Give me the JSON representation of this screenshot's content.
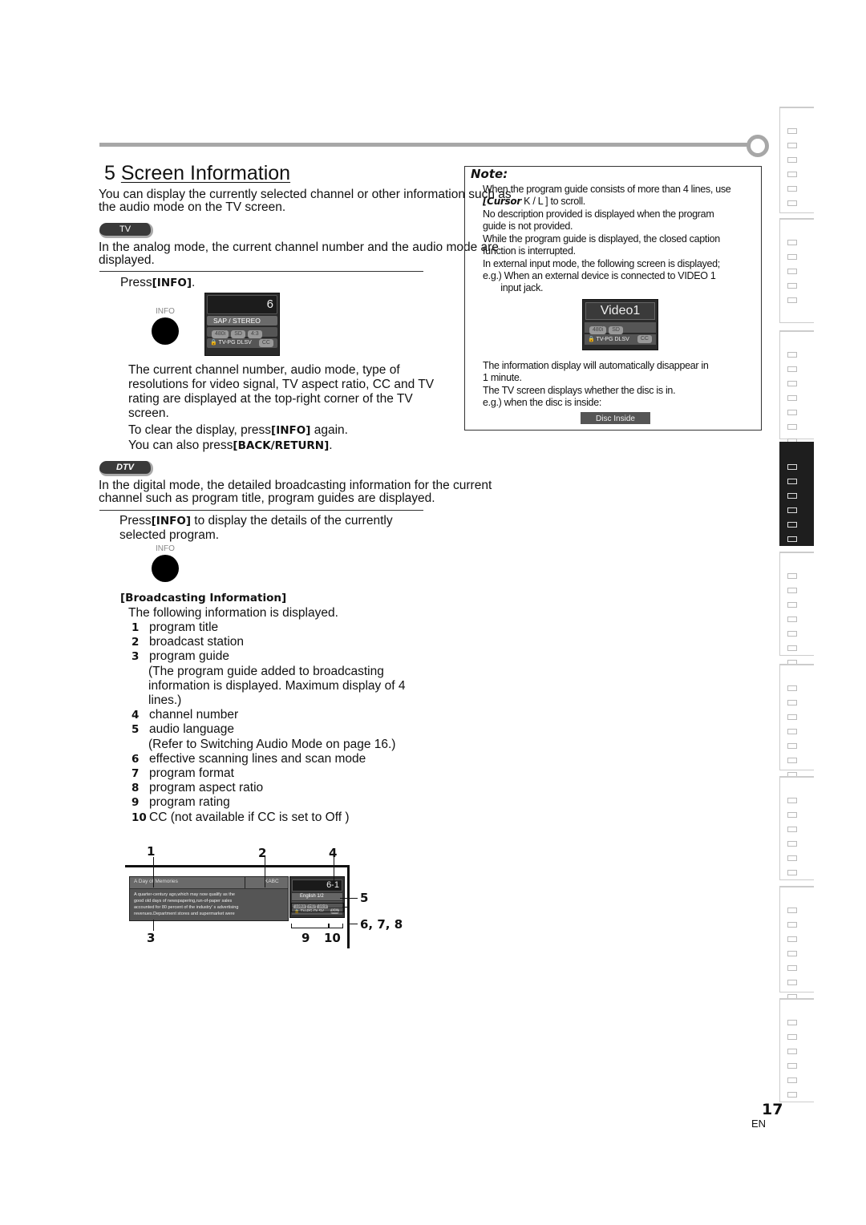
{
  "header": {
    "section_number": "5",
    "title": "Screen Information"
  },
  "intro": {
    "line1": "You can display the currently selected channel or other information such as",
    "line2": "the audio mode on the TV screen."
  },
  "tv_section": {
    "badge": "TV",
    "desc_line1": "In the analog mode, the current channel number and the audio mode are",
    "desc_line2": "displayed.",
    "step_press": "Press",
    "step_key": "[INFO]",
    "step_end": ".",
    "button_label": "INFO",
    "osd": {
      "channel": "6",
      "audio": "SAP  / STEREO",
      "chips": [
        "480i",
        "SD",
        "4:3"
      ],
      "rating": "TV-PG DLSV",
      "cc": "CC"
    },
    "explain": [
      "The current channel number, audio mode, type of",
      "resolutions for video signal, TV aspect ratio, CC and TV",
      "rating are displayed at the top-right corner of the TV",
      "screen."
    ],
    "clear_pre": "To clear the display, press",
    "clear_key": "[INFO]",
    "clear_post": " again.",
    "also_pre": "You can also press",
    "also_key": "[BACK/RETURN]",
    "also_post": "."
  },
  "dtv_section": {
    "badge": "DTV",
    "desc_line1": "In the digital mode, the detailed broadcasting information for the current",
    "desc_line2": "channel such as program title, program guides are displayed.",
    "step_press": "Press",
    "step_key": "[INFO]",
    "step_line1_end": " to display the details of the currently",
    "step_line2": "selected program.",
    "button_label": "INFO",
    "bi_heading": "[Broadcasting Information]",
    "bi_intro": "The following information is displayed.",
    "items": [
      {
        "num": "1",
        "text": "program title"
      },
      {
        "num": "2",
        "text": "broadcast station"
      },
      {
        "num": "3",
        "text": "program guide"
      },
      {
        "num": "",
        "text": "(The program guide added to broadcasting"
      },
      {
        "num": "",
        "text": "information is displayed. Maximum display of 4"
      },
      {
        "num": "",
        "text": "lines.)"
      },
      {
        "num": "4",
        "text": "channel number"
      },
      {
        "num": "5",
        "text": "audio language"
      },
      {
        "num": "",
        "text": "(Refer to  Switching Audio Mode  on page 16.)"
      },
      {
        "num": "6",
        "text": "effective scanning lines and scan mode"
      },
      {
        "num": "7",
        "text": "program format"
      },
      {
        "num": "8",
        "text": "program aspect ratio"
      },
      {
        "num": "9",
        "text": "program rating"
      },
      {
        "num": "10",
        "text": "CC (not available if CC is set to  Off )"
      }
    ],
    "diagram": {
      "title": "A Day of Memories",
      "station": "KABC",
      "channel": "6-1",
      "guide": [
        "A quarter-century ago,which may now qualify as the",
        "good old days of newspapering,run-of-paper sales",
        "accounted for 80 percent of the industry' s advertising",
        "revenues.Department stores and supermarket were"
      ],
      "audio": "English 1/2",
      "chips": [
        "1080i",
        "HD",
        "16:9"
      ],
      "rating": "TV-PG DLSV",
      "cc": "CC",
      "callouts": {
        "c1": "1",
        "c2": "2",
        "c3": "3",
        "c4": "4",
        "c5": "5",
        "c678": "6, 7, 8",
        "c9": "9",
        "c10": "10"
      }
    }
  },
  "note": {
    "title": "Note:",
    "lines": [
      "When the program guide consists of more than 4 lines, use",
      "to scroll.",
      " No description provided   is displayed when the program",
      "guide is not provided.",
      "While the program guide is displayed, the closed caption",
      "function is interrupted.",
      "In external input mode, the following screen is displayed;",
      "e.g.) When an external device is connected to VIDEO 1",
      "       input jack."
    ],
    "cursor_key": "[Cursor",
    "cursor_glyphs": "K / L ]",
    "video_osd": {
      "label": "Video1",
      "chips": [
        "480i",
        "SD"
      ],
      "rating": "TV-PG DLSV",
      "cc": "CC"
    },
    "lines2": [
      "The information display will automatically disappear in",
      "1 minute.",
      "The TV screen displays whether the disc is in.",
      "e.g.) when the disc is inside:"
    ],
    "disc_label": "Disc Inside"
  },
  "sidebar": {
    "tabs": [
      {
        "glyph_count": 6,
        "active": false
      },
      {
        "glyph_count": 5,
        "active": false
      },
      {
        "glyph_count": 7,
        "active": false
      },
      {
        "glyph_count": 6,
        "active": true
      },
      {
        "glyph_count": 7,
        "active": false
      },
      {
        "glyph_count": 7,
        "active": false
      },
      {
        "glyph_count": 6,
        "active": false
      },
      {
        "glyph_count": 7,
        "active": false
      },
      {
        "glyph_count": 6,
        "active": false
      }
    ]
  },
  "footer": {
    "page_number": "17",
    "lang": "EN"
  }
}
